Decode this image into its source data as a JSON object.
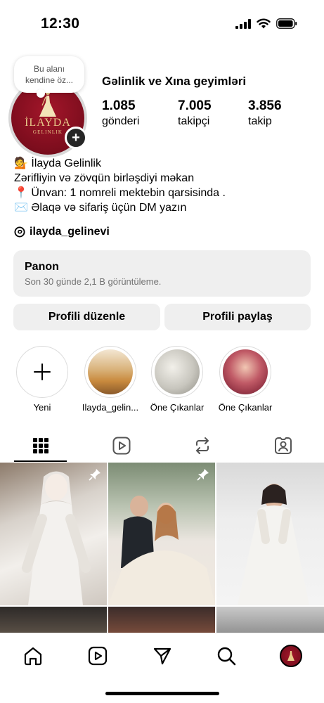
{
  "status_bar": {
    "time": "12:30"
  },
  "profile": {
    "note": "Bu alanı kendine öz...",
    "avatar_brand": "İLAYDA",
    "avatar_sub": "GELINLIK",
    "name": "Gəlinlik ve Xına geyimləri",
    "stats": [
      {
        "value": "1.085",
        "label": "gönderi"
      },
      {
        "value": "7.005",
        "label": "takipçi"
      },
      {
        "value": "3.856",
        "label": "takip"
      }
    ],
    "bio": [
      "💁 İlayda Gelinlik",
      "Zərifliyin və zövqün birləşdiyi məkan",
      "📍 Ünvan: 1 nomreli mektebin qarsisinda .",
      "✉️ Əlaqə və sifariş üçün DM yazın"
    ],
    "threads_handle": "ilayda_gelinevi"
  },
  "dashboard": {
    "title": "Panon",
    "subtitle": "Son 30 günde 2,1 B görüntüleme."
  },
  "buttons": {
    "edit_profile": "Profili düzenle",
    "share_profile": "Profili paylaş"
  },
  "highlights": [
    {
      "label": "Yeni",
      "icon": "plus-icon"
    },
    {
      "label": "Ilayda_gelin...",
      "color": "#c98a3e"
    },
    {
      "label": "Öne Çıkanlar",
      "color": "#c8c6be"
    },
    {
      "label": "Öne Çıkanlar",
      "color": "#9b3a4a"
    }
  ],
  "tabs": [
    {
      "name": "grid",
      "icon": "grid-icon",
      "active": true
    },
    {
      "name": "reels",
      "icon": "reels-icon",
      "active": false
    },
    {
      "name": "reposts",
      "icon": "repost-icon",
      "active": false
    },
    {
      "name": "tagged",
      "icon": "tagged-icon",
      "active": false
    }
  ],
  "bottom_nav": [
    {
      "name": "home",
      "icon": "home-icon"
    },
    {
      "name": "reels",
      "icon": "reels-icon"
    },
    {
      "name": "messages",
      "icon": "send-icon"
    },
    {
      "name": "search",
      "icon": "search-icon"
    },
    {
      "name": "profile",
      "icon": "avatar"
    }
  ],
  "colors": {
    "brand": "#8b0f22",
    "brand_gold": "#e8c98a",
    "button_bg": "#efefef"
  }
}
